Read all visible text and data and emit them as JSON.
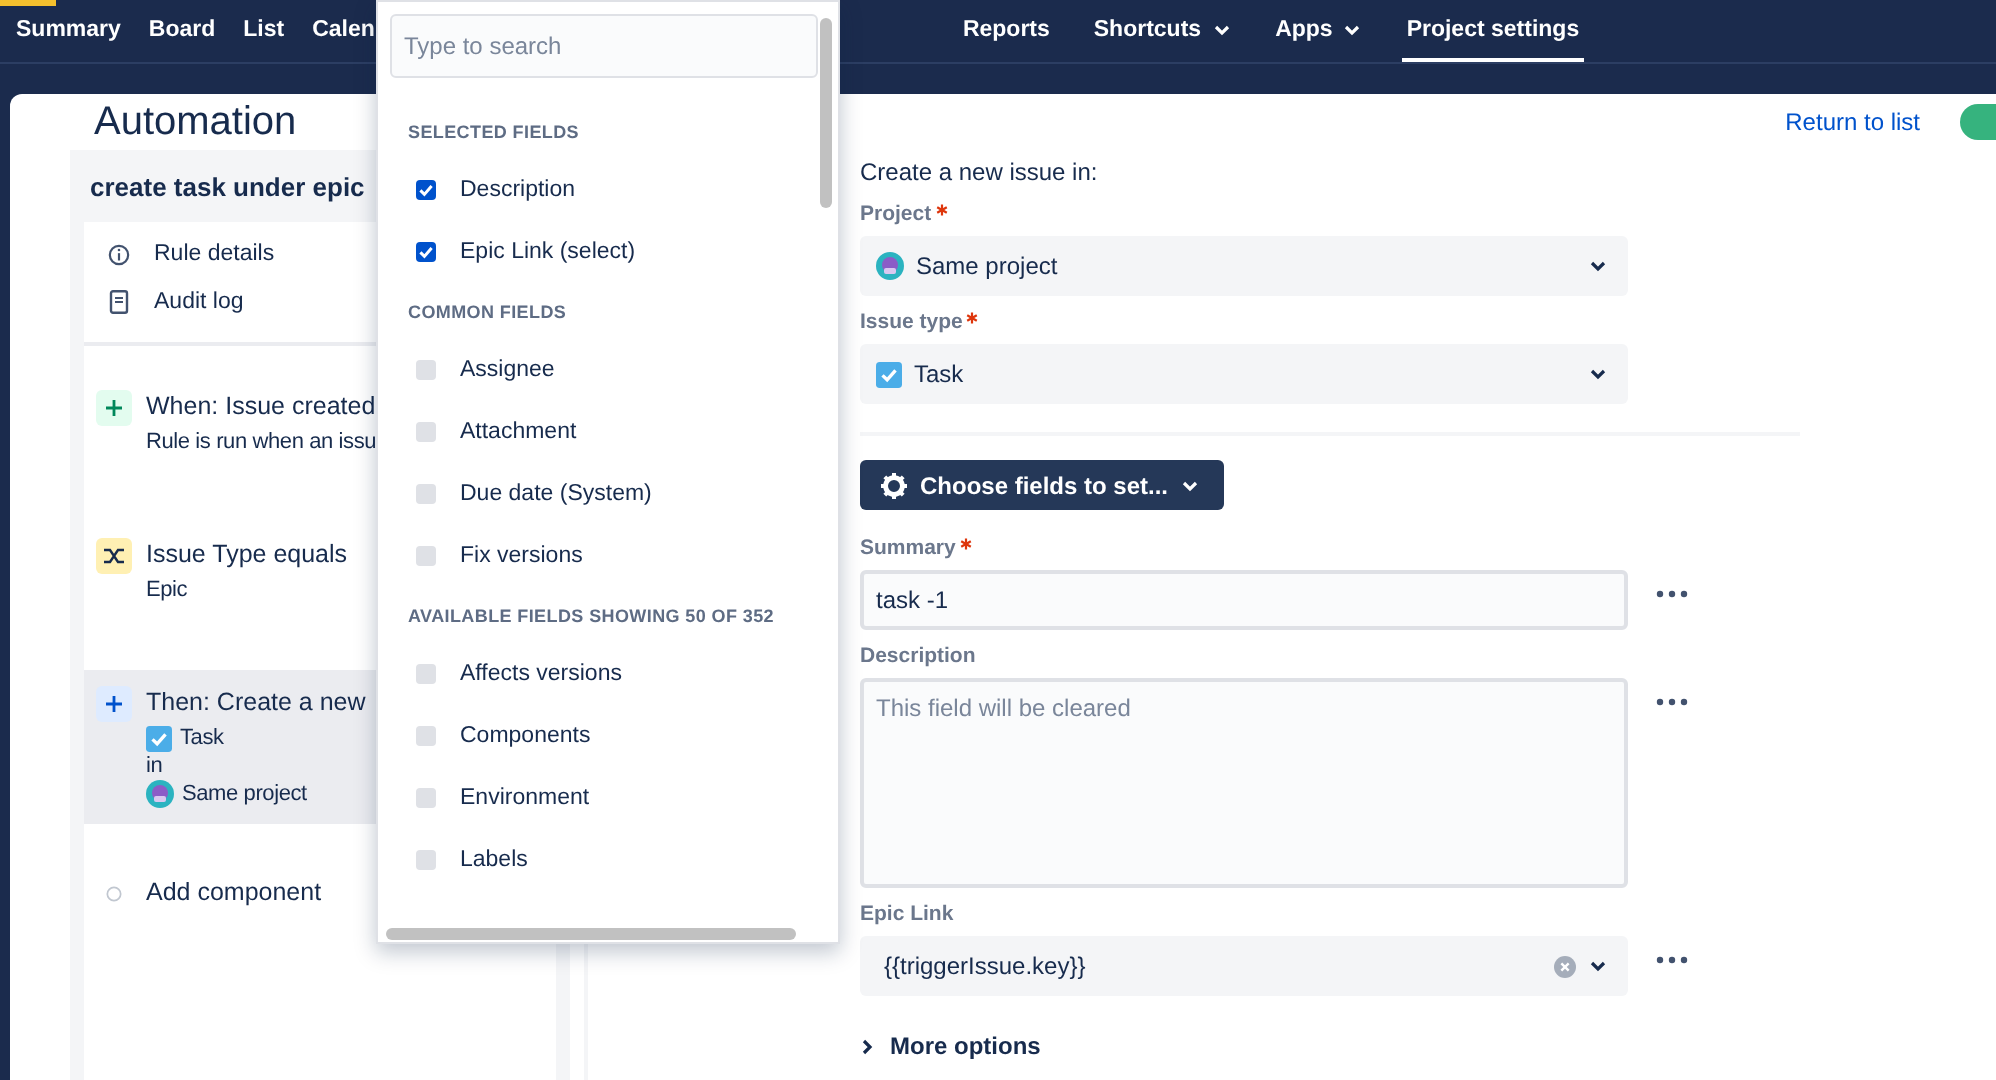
{
  "nav": {
    "items": [
      {
        "label": "Summary",
        "selected": false,
        "menu": false
      },
      {
        "label": "Board",
        "selected": false,
        "menu": false
      },
      {
        "label": "List",
        "selected": false,
        "menu": false
      },
      {
        "label": "Calen",
        "selected": false,
        "menu": false
      },
      {
        "label": "Reports",
        "selected": false,
        "menu": false
      },
      {
        "label": "Shortcuts",
        "selected": false,
        "menu": true
      },
      {
        "label": "Apps",
        "selected": false,
        "menu": true
      },
      {
        "label": "Project settings",
        "selected": true,
        "menu": false
      }
    ]
  },
  "header": {
    "title": "Automation",
    "return_link": "Return to list"
  },
  "rule": {
    "name": "create task under epic",
    "menu": [
      {
        "kind": "info",
        "label": "Rule details"
      },
      {
        "kind": "log",
        "label": "Audit log"
      }
    ],
    "components": [
      {
        "kind": "trigger",
        "title": "When: Issue created",
        "selected": false,
        "lines": [
          {
            "kind": "text",
            "text": "Rule is run when an issu"
          }
        ]
      },
      {
        "kind": "condition",
        "title": "Issue Type equals",
        "selected": false,
        "lines": [
          {
            "kind": "text",
            "text": "Epic"
          }
        ]
      },
      {
        "kind": "action",
        "title": "Then: Create a new",
        "selected": true,
        "lines": [
          {
            "kind": "issue-type",
            "text": "Task"
          },
          {
            "kind": "text",
            "text": "in"
          },
          {
            "kind": "project",
            "text": "Same project"
          }
        ]
      },
      {
        "kind": "add",
        "title": "Add component",
        "selected": false
      }
    ]
  },
  "form": {
    "intro": "Create a new issue in:",
    "targets": [
      {
        "kind": "project",
        "label": "Project",
        "required": true,
        "value": "Same project"
      },
      {
        "kind": "issue-type",
        "label": "Issue type",
        "required": true,
        "value": "Task"
      }
    ],
    "choose_button": "Choose fields to set...",
    "fields": [
      {
        "kind": "text",
        "label": "Summary",
        "required": true,
        "value": "task -1"
      },
      {
        "kind": "textarea",
        "label": "Description",
        "required": false,
        "placeholder": "This field will be cleared"
      },
      {
        "kind": "select",
        "label": "Epic Link",
        "required": false,
        "value": "{{triggerIssue.key}}",
        "clearable": true
      }
    ],
    "more_options": "More options"
  },
  "dropdown": {
    "search": {
      "placeholder": "Type to search"
    },
    "sections": [
      {
        "title": "SELECTED FIELDS",
        "items": [
          {
            "label": "Description",
            "checked": true
          },
          {
            "label": "Epic Link (select)",
            "checked": true
          }
        ]
      },
      {
        "title": "COMMON FIELDS",
        "items": [
          {
            "label": "Assignee",
            "checked": false
          },
          {
            "label": "Attachment",
            "checked": false
          },
          {
            "label": "Due date (System)",
            "checked": false
          },
          {
            "label": "Fix versions",
            "checked": false
          }
        ]
      },
      {
        "title": "AVAILABLE FIELDS SHOWING 50 OF 352",
        "items": [
          {
            "label": "Affects versions",
            "checked": false
          },
          {
            "label": "Components",
            "checked": false
          },
          {
            "label": "Environment",
            "checked": false
          },
          {
            "label": "Labels",
            "checked": false
          }
        ]
      }
    ]
  }
}
